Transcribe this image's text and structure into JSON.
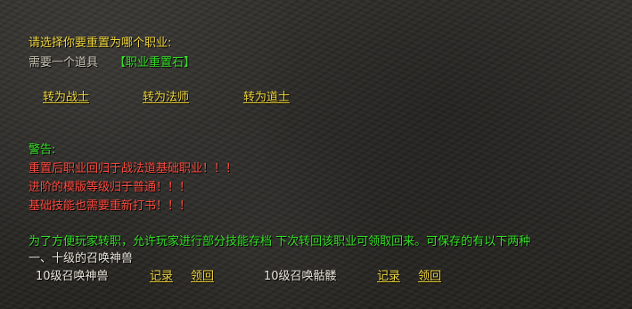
{
  "prompt": {
    "question": "请选择你要重置为哪个职业:",
    "requirement_prefix": "需要一个道具",
    "requirement_item": "【职业重置石】"
  },
  "actions": [
    {
      "label": "转为战士"
    },
    {
      "label": "转为法师"
    },
    {
      "label": "转为道士"
    }
  ],
  "warning": {
    "title": "警告:",
    "lines": [
      "重置后职业回归于战法道基础职业！！！",
      "进阶的模版等级归于普通！！！",
      "基础技能也需要重新打书！！！"
    ]
  },
  "notice": {
    "line1": "为了方便玩家转职，允许玩家进行部分技能存档   下次转回该职业可领取回来。可保存的有以下两种",
    "line2": "一、十级的召唤神兽"
  },
  "skills": [
    {
      "name": "10级召唤神兽",
      "record": "记录",
      "claim": "领回"
    },
    {
      "name": "10级召唤骷髅",
      "record": "记录",
      "claim": "领回"
    }
  ],
  "colors": {
    "gold": "#f0d63d",
    "gray": "#cbc7b7",
    "green": "#35df27",
    "red": "#ff4a3f",
    "white": "#e8e4d9"
  }
}
